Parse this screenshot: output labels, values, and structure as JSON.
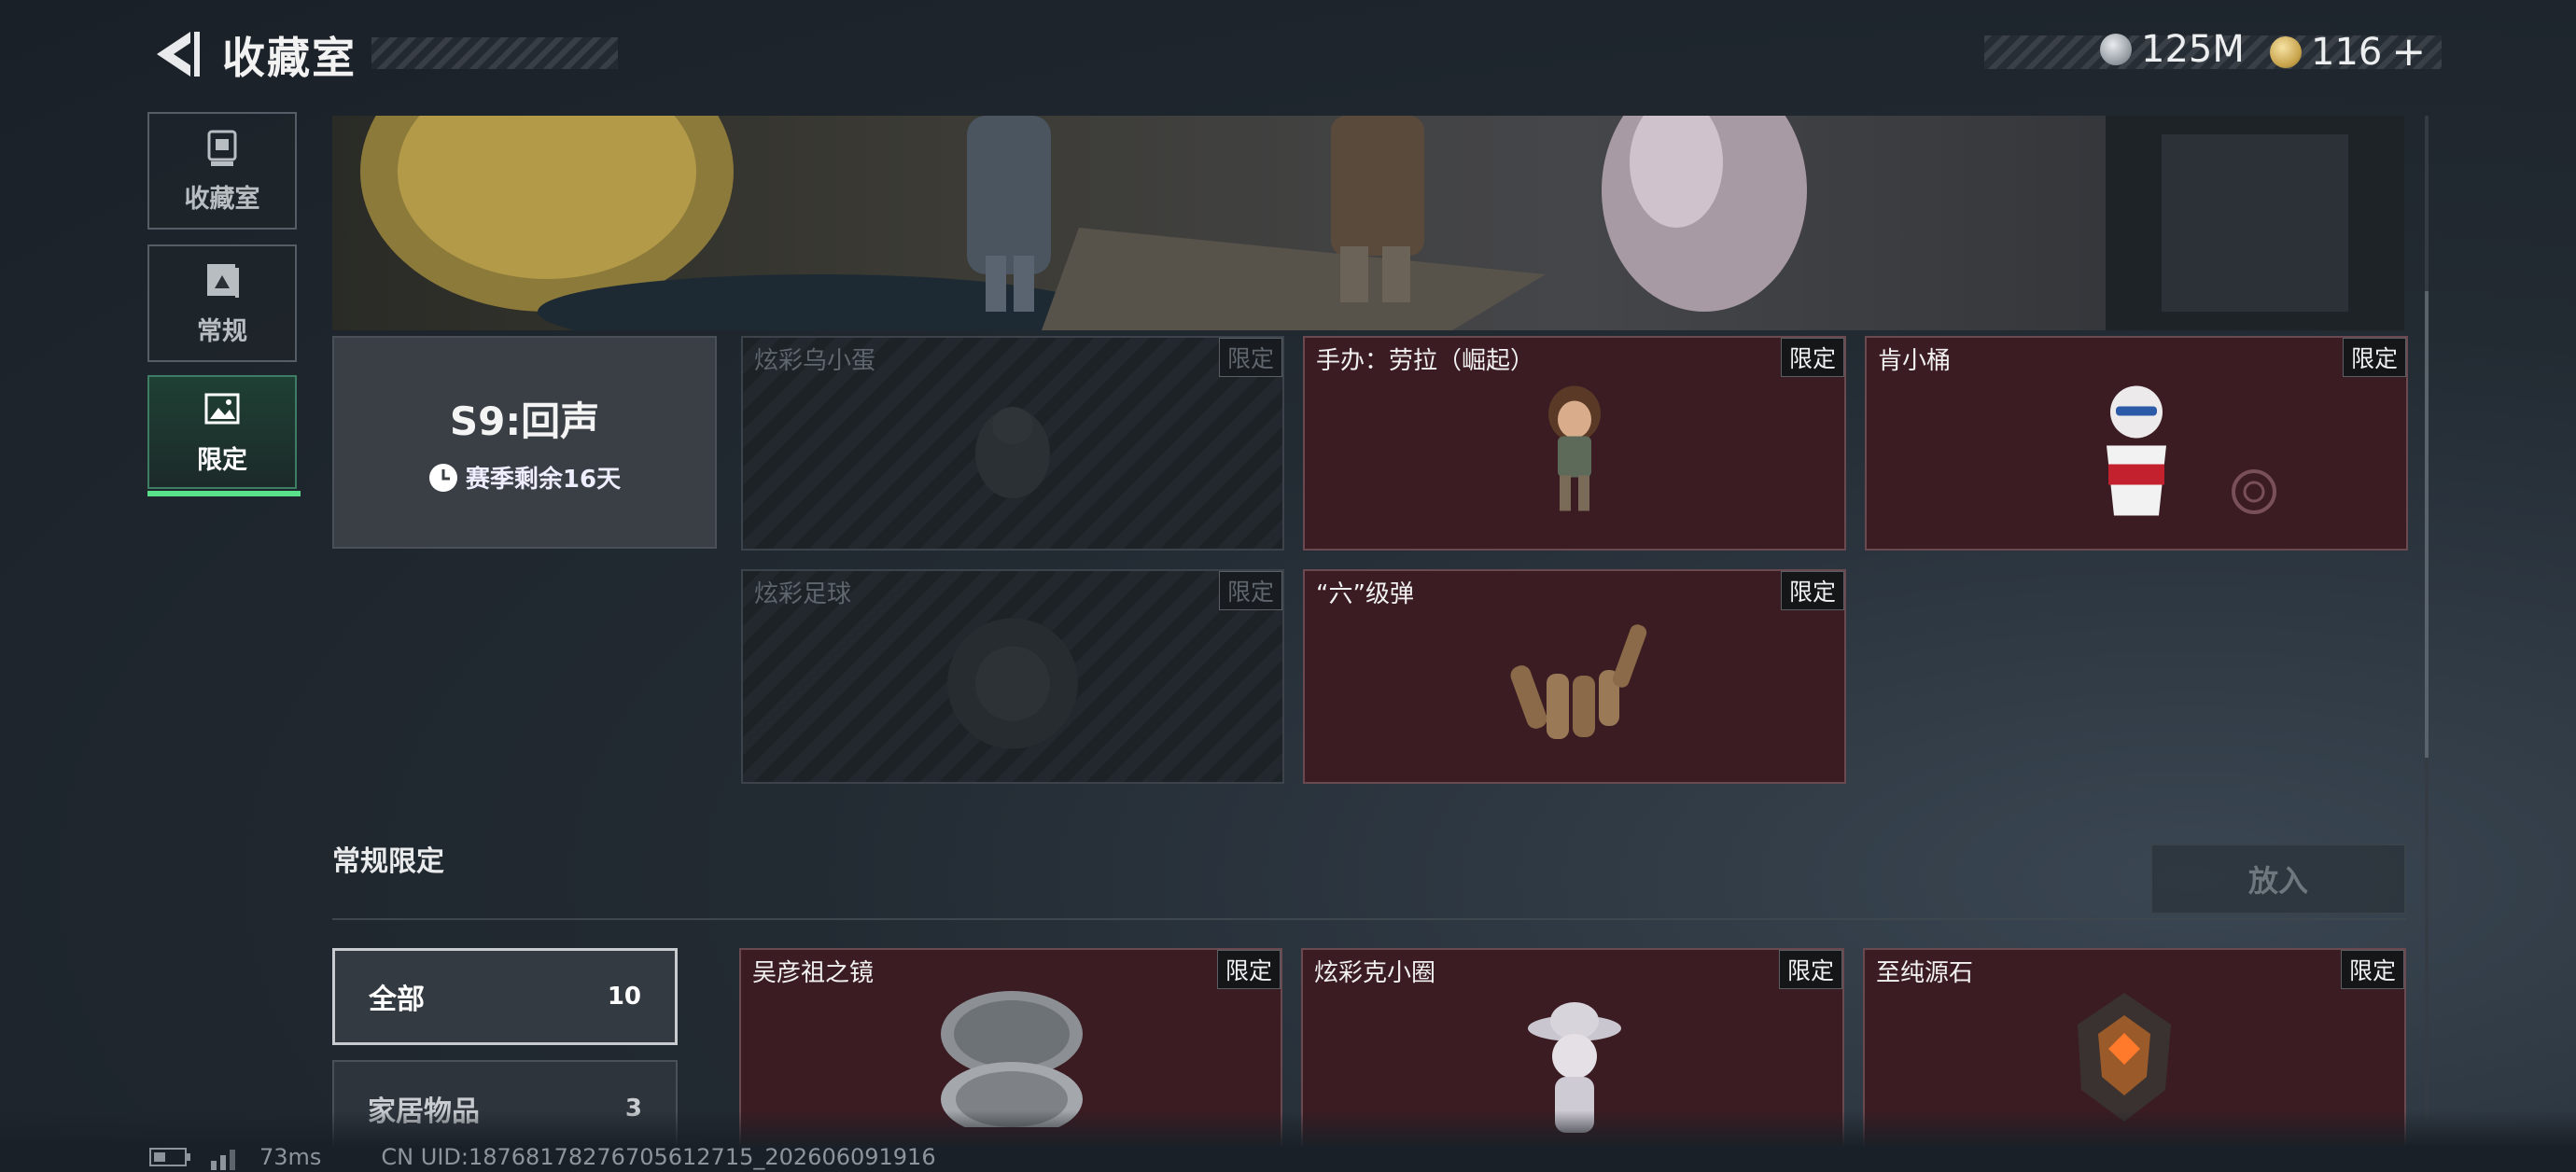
{
  "header": {
    "title": "收藏室",
    "currency_silver": "125M",
    "currency_gold": "116",
    "plus": "+"
  },
  "sidebar": {
    "items": [
      {
        "label": "收藏室",
        "icon": "trophy-icon",
        "active": false
      },
      {
        "label": "常规",
        "icon": "book-icon",
        "active": false
      },
      {
        "label": "限定",
        "icon": "image-icon",
        "active": true
      }
    ]
  },
  "season": {
    "title": "S9:回声",
    "remaining": "赛季剩余16天"
  },
  "season_items": [
    {
      "name": "炫彩乌小蛋",
      "tag": "限定",
      "state": "locked"
    },
    {
      "name": "手办：劳拉（崛起）",
      "tag": "限定",
      "state": "owned"
    },
    {
      "name": "肯小桶",
      "tag": "限定",
      "state": "owned"
    },
    {
      "name": "炫彩足球",
      "tag": "限定",
      "state": "locked"
    },
    {
      "name": "“六”级弹",
      "tag": "限定",
      "state": "owned"
    }
  ],
  "regular_section": {
    "title": "常规限定",
    "put_button": "放入",
    "filters": [
      {
        "label": "全部",
        "count": "10",
        "active": true
      },
      {
        "label": "家居物品",
        "count": "3",
        "active": false
      }
    ],
    "items": [
      {
        "name": "吴彦祖之镜",
        "tag": "限定"
      },
      {
        "name": "炫彩克小圈",
        "tag": "限定"
      },
      {
        "name": "至纯源石",
        "tag": "限定"
      }
    ]
  },
  "footer": {
    "ping": "73ms",
    "uid": "CN UID:18768178276705612715_202606091916"
  },
  "colors": {
    "accent_green": "#58e08a",
    "owned_card": "#3a1c22"
  }
}
